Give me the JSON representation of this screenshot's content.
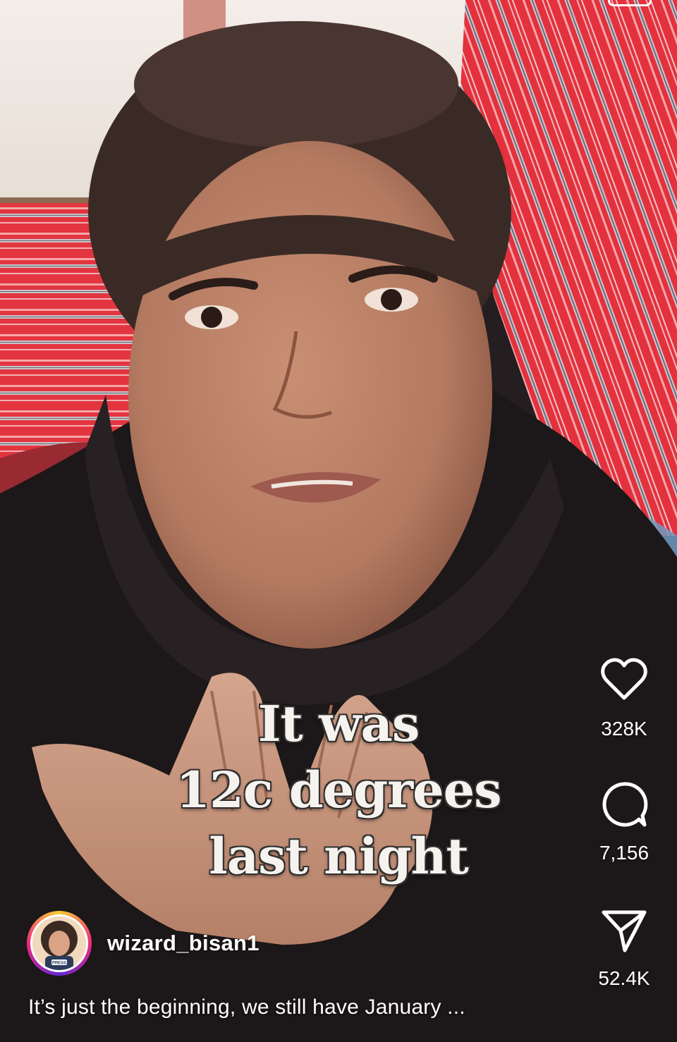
{
  "video": {
    "overlay_caption_lines": [
      "It was",
      "12c degrees",
      "last night"
    ]
  },
  "actions": {
    "like": {
      "icon": "heart-icon",
      "count": "328K"
    },
    "comment": {
      "icon": "comment-bubble-icon",
      "count": "7,156"
    },
    "share": {
      "icon": "paper-plane-icon",
      "count": "52.4K"
    }
  },
  "author": {
    "username": "wizard_bisan1",
    "avatar_badge": "PRESS"
  },
  "post": {
    "description": "It’s just the beginning, we still have January ..."
  },
  "colors": {
    "tent_red": "#e8323e",
    "hoodie": "#1b1718",
    "ui_text": "#ffffff"
  }
}
